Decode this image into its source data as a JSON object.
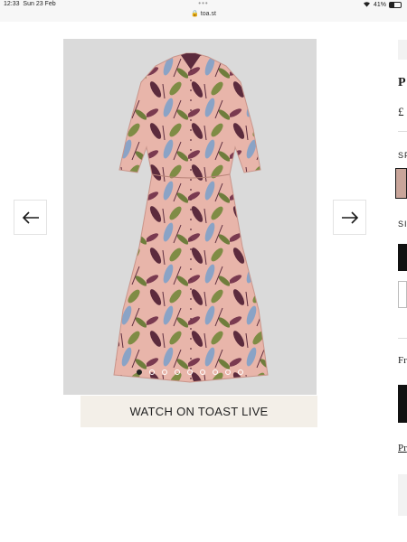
{
  "status": {
    "time": "12:33",
    "date": "Sun 23 Feb",
    "url": "toa.st",
    "battery": "41%",
    "battery_level": 0.41,
    "more": "•••"
  },
  "carousel": {
    "prev_label": "Previous image",
    "next_label": "Next image",
    "slide_count": 9,
    "active_slide": 1
  },
  "watch_button": "WATCH ON TOAST LIVE",
  "colors": {
    "dress_base": "#e8b5aa",
    "page_bg": "#ffffff",
    "photo_bg": "#dadada",
    "watch_bg": "#f3efe8"
  },
  "right_panel": {
    "title_partial": "P",
    "price_partial": "£",
    "colour_label_partial": "SP",
    "size_label_partial": "SI",
    "free_text_partial": "Fr",
    "link_partial": "Pr"
  }
}
